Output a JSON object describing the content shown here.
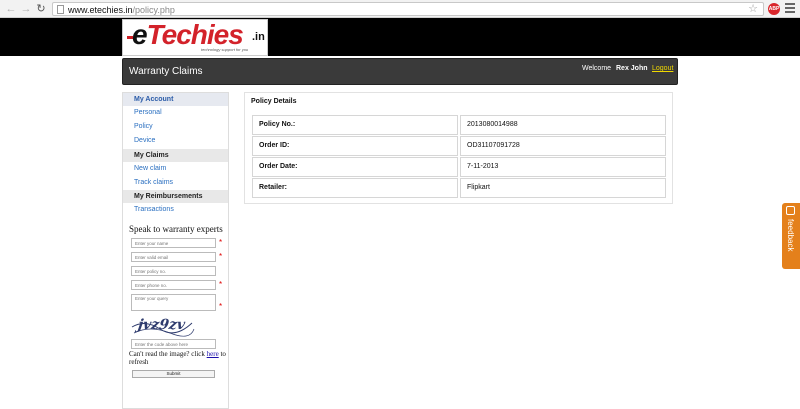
{
  "browser": {
    "url_host": "www.etechies.in",
    "url_path": "/policy.php",
    "abp_label": "ABP"
  },
  "logo": {
    "e": "e",
    "techies": "Techies",
    "tld": ".in",
    "tagline": "technology support for you"
  },
  "titlebar": {
    "title": "Warranty Claims",
    "welcome": "Welcome",
    "user": "Rex John",
    "logout": "Logout"
  },
  "sidebar": {
    "my_account": "My Account",
    "personal": "Personal",
    "policy": "Policy",
    "device": "Device",
    "my_claims": "My Claims",
    "new_claim": "New claim",
    "track_claims": "Track claims",
    "my_reimbursements": "My Reimbursements",
    "transactions": "Transactions"
  },
  "contact_form": {
    "heading": "Speak to warranty experts",
    "name_placeholder": "Enter your name",
    "email_placeholder": "Enter valid email",
    "policy_placeholder": "Enter policy no.",
    "phone_placeholder": "Enter phone no.",
    "query_placeholder": "Enter your query",
    "captcha_text": "jvz9zv",
    "captcha_input_placeholder": "Enter the code above here",
    "cant_read_prefix": "Can't read the image? click ",
    "cant_read_link": "here",
    "cant_read_suffix": " to refresh",
    "submit_label": "Submit"
  },
  "policy_details": {
    "title": "Policy Details",
    "rows": [
      {
        "label": "Policy No.:",
        "value": "2013080014988"
      },
      {
        "label": "Order ID:",
        "value": "OD31107091728"
      },
      {
        "label": "Order Date:",
        "value": "7-11-2013"
      },
      {
        "label": "Retailer:",
        "value": "Flipkart"
      }
    ]
  },
  "feedback": {
    "label": "feedback"
  }
}
